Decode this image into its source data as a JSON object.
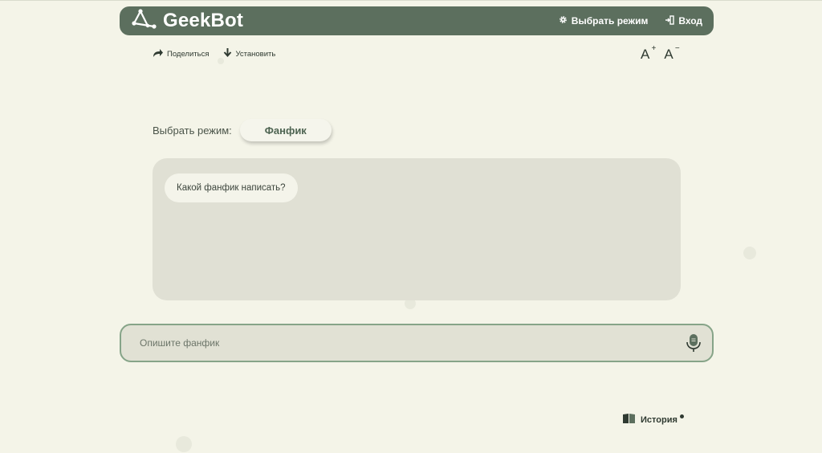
{
  "header": {
    "title": "GeekBot",
    "mode_button": "Выбрать режим",
    "login_button": "Вход"
  },
  "toolbar": {
    "share": "Поделиться",
    "install": "Установить",
    "font_increase": "A",
    "font_decrease": "A"
  },
  "mode": {
    "label": "Выбрать режим:",
    "selected": "Фанфик"
  },
  "chat": {
    "messages": [
      {
        "from": "bot",
        "text": "Какой фанфик написать?"
      }
    ]
  },
  "input": {
    "placeholder": "Опишите фанфик",
    "value": ""
  },
  "footer": {
    "history": "История"
  },
  "colors": {
    "background": "#f4f4e8",
    "header": "#5c6f5e",
    "panel": "#e0e0d4",
    "accent_border": "#86a488",
    "mode_text": "#4e6452"
  },
  "icons": {
    "logo": "geekbot-logo-icon",
    "mode": "gear-icon",
    "login": "login-door-icon",
    "share": "share-arrow-icon",
    "install": "download-arrow-icon",
    "mic": "microphone-icon",
    "history": "book-icon"
  }
}
